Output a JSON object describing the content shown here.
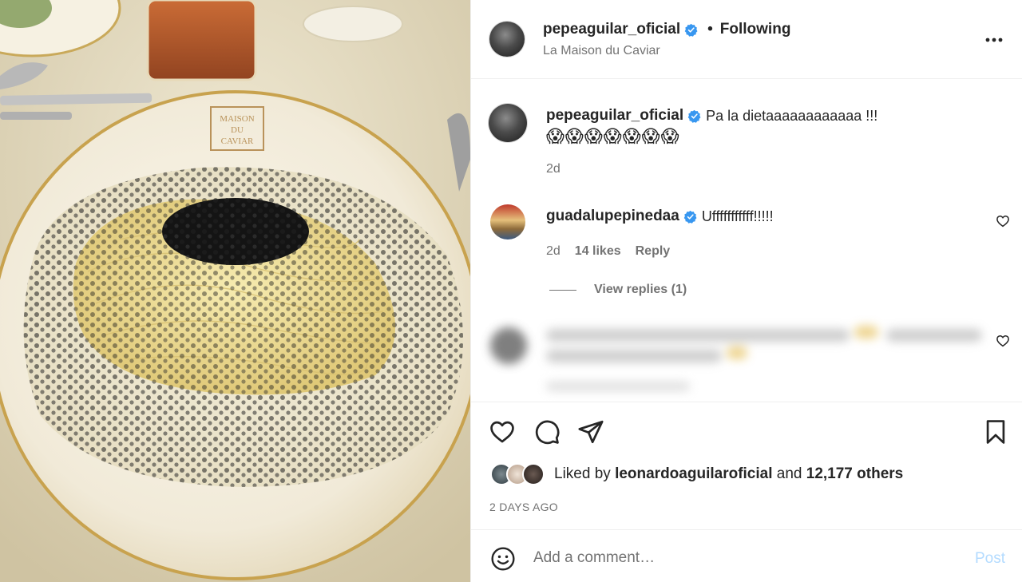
{
  "photo": {
    "description_icon": "food-photo",
    "plate_logo_lines": [
      "MAISON",
      "DU",
      "CAVIAR"
    ]
  },
  "header": {
    "username": "pepeaguilar_oficial",
    "separator": "•",
    "follow_label": "Following",
    "location": "La Maison du Caviar",
    "more_icon": "more-horizontal-icon"
  },
  "caption": {
    "username": "pepeaguilar_oficial",
    "text": "Pa la dietaaaaaaaaaaaa !!!",
    "emojis": "😱😱😱😱😱😱😱",
    "age": "2d"
  },
  "comments": [
    {
      "username": "guadalupepinedaa",
      "text": "Ufffffffffff!!!!!",
      "age": "2d",
      "likes": "14 likes",
      "reply_label": "Reply",
      "view_replies": "View replies (1)"
    }
  ],
  "liked_by": {
    "prefix": "Liked by",
    "user": "leonardoaguilaroficial",
    "and": "and",
    "others": "12,177 others"
  },
  "post_age": "2 DAYS AGO",
  "comment_box": {
    "placeholder": "Add a comment…",
    "post_label": "Post"
  },
  "colors": {
    "verified": "#3897f0",
    "post_disabled": "#b3dbff",
    "secondary_text": "#737373"
  }
}
